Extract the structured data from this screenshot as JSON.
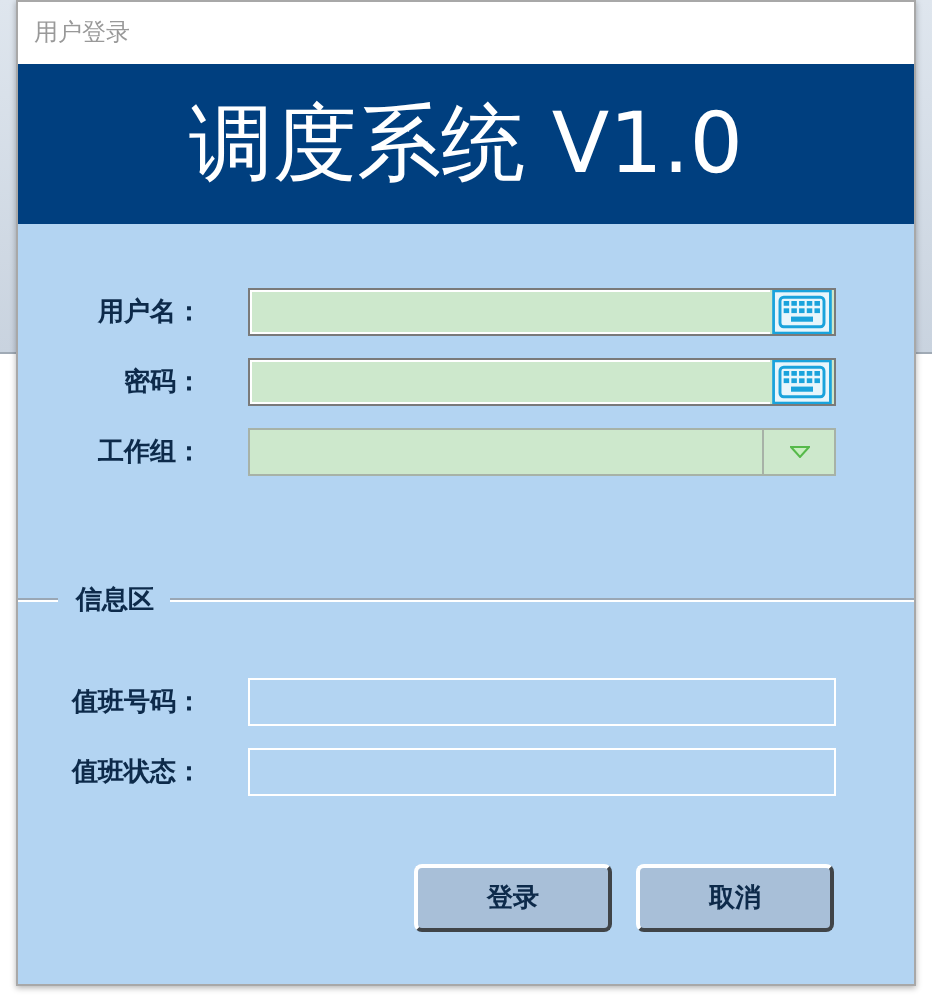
{
  "dialog": {
    "title": "用户登录",
    "banner": "调度系统 V1.0",
    "login_fields": [
      {
        "label": "用户名：",
        "kind": "keyboard"
      },
      {
        "label": "密码：",
        "kind": "keyboard"
      },
      {
        "label": "工作组：",
        "kind": "dropdown"
      }
    ],
    "info_section": {
      "legend": "信息区",
      "fields": [
        {
          "label": "值班号码："
        },
        {
          "label": "值班状态："
        }
      ]
    },
    "buttons": [
      "登录",
      "取消"
    ]
  }
}
